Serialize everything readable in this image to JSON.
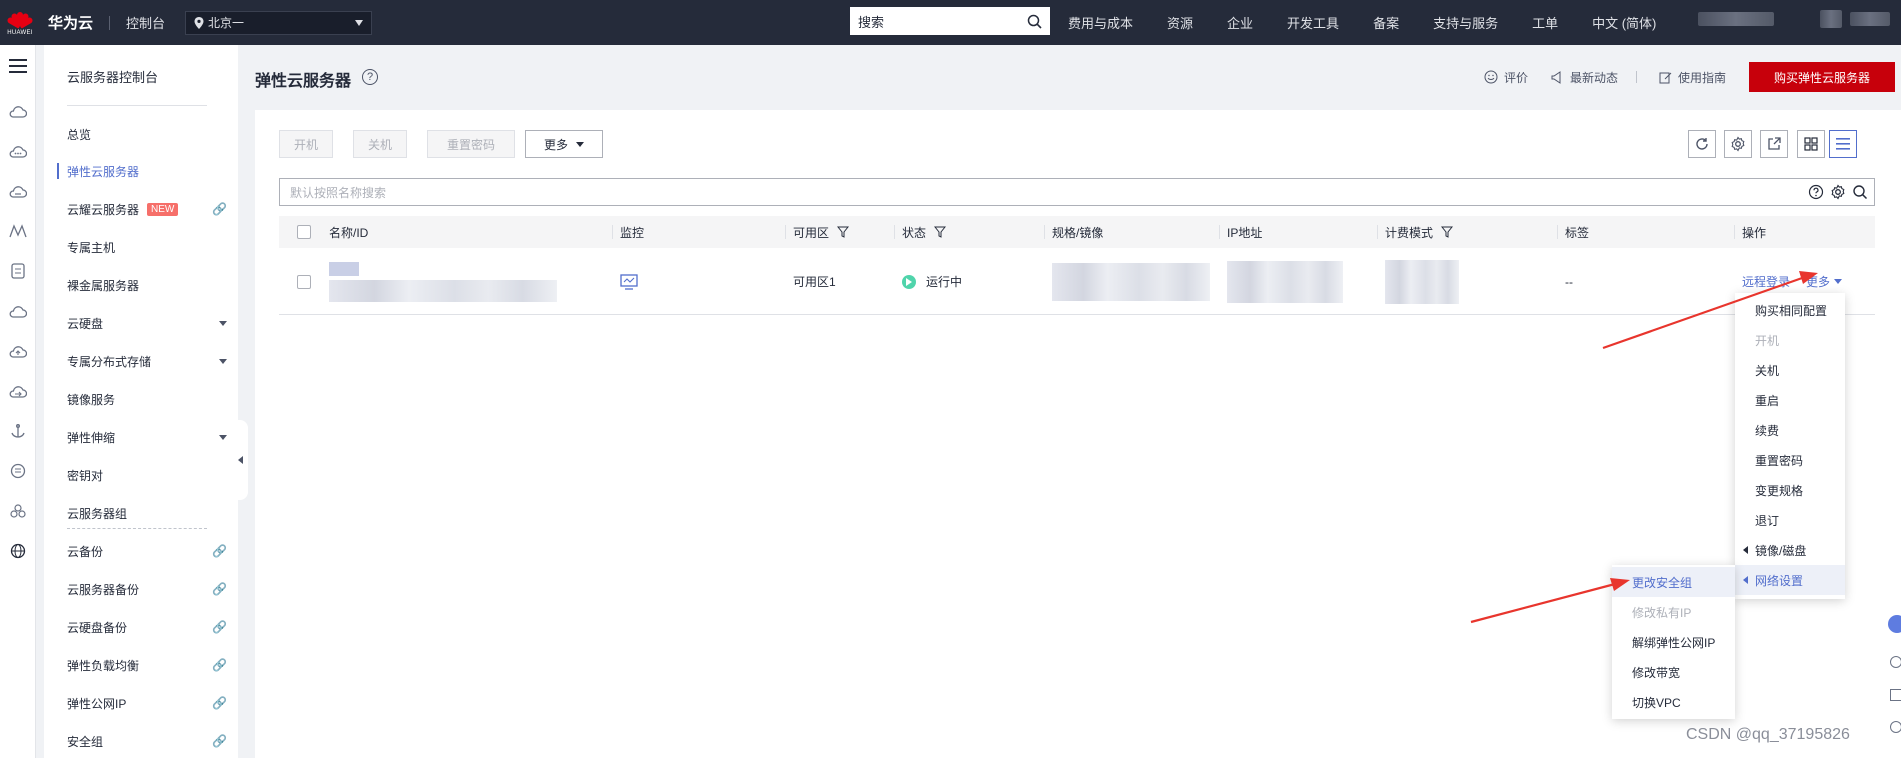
{
  "topbar": {
    "logo_text": "HUAWEI",
    "brand": "华为云",
    "console": "控制台",
    "region": "北京一",
    "search_placeholder": "搜索",
    "nav": [
      "费用与成本",
      "资源",
      "企业",
      "开发工具",
      "备案",
      "支持与服务",
      "工单",
      "中文 (简体)"
    ]
  },
  "rail_icons": [
    "menu-icon",
    "cloud-icon",
    "cloud-chat-icon",
    "cloud-sync-icon",
    "chart-icon",
    "document-icon",
    "cloud-outline-icon",
    "cloud-upload-icon",
    "cloud-arrow-icon",
    "anchor-icon",
    "tag-icon",
    "cluster-icon",
    "globe-icon"
  ],
  "sidebar": {
    "title": "云服务器控制台",
    "items": [
      {
        "label": "总览"
      },
      {
        "label": "弹性云服务器",
        "active": true
      },
      {
        "label": "云耀云服务器",
        "badge": "NEW",
        "trail": "link"
      },
      {
        "label": "专属主机"
      },
      {
        "label": "裸金属服务器"
      },
      {
        "label": "云硬盘",
        "trail": "chevron"
      },
      {
        "label": "专属分布式存储",
        "trail": "chevron"
      },
      {
        "label": "镜像服务"
      },
      {
        "label": "弹性伸缩",
        "trail": "chevron"
      },
      {
        "label": "密钥对"
      },
      {
        "label": "云服务器组"
      },
      {
        "label": "云备份",
        "trail": "link"
      },
      {
        "label": "云服务器备份",
        "trail": "link"
      },
      {
        "label": "云硬盘备份",
        "trail": "link"
      },
      {
        "label": "弹性负载均衡",
        "trail": "link"
      },
      {
        "label": "弹性公网IP",
        "trail": "link"
      },
      {
        "label": "安全组",
        "trail": "link"
      }
    ]
  },
  "page": {
    "title": "弹性云服务器",
    "rate": "评价",
    "news": "最新动态",
    "guide": "使用指南",
    "buy": "购买弹性云服务器"
  },
  "toolbar": {
    "start": "开机",
    "stop": "关机",
    "reset_pwd": "重置密码",
    "more": "更多"
  },
  "filter": {
    "placeholder": "默认按照名称搜索"
  },
  "table": {
    "headers": [
      "名称/ID",
      "监控",
      "可用区",
      "状态",
      "规格/镜像",
      "IP地址",
      "计费模式",
      "标签",
      "操作"
    ],
    "row": {
      "zone": "可用区1",
      "status": "运行中",
      "tags": "--",
      "remote_login": "远程登录",
      "more": "更多"
    }
  },
  "more_menu": [
    {
      "label": "购买相同配置"
    },
    {
      "label": "开机",
      "disabled": true
    },
    {
      "label": "关机"
    },
    {
      "label": "重启"
    },
    {
      "label": "续费"
    },
    {
      "label": "重置密码"
    },
    {
      "label": "变更规格"
    },
    {
      "label": "退订"
    },
    {
      "label": "镜像/磁盘",
      "submenu": true
    },
    {
      "label": "网络设置",
      "submenu": true,
      "highlighted": true
    }
  ],
  "network_menu": [
    {
      "label": "更改安全组",
      "highlighted": true
    },
    {
      "label": "修改私有IP",
      "disabled": true
    },
    {
      "label": "解绑弹性公网IP"
    },
    {
      "label": "修改带宽"
    },
    {
      "label": "切换VPC"
    }
  ],
  "watermark": "CSDN @qq_37195826",
  "colors": {
    "topbar": "#252b3a",
    "accent": "#526ecc",
    "buy": "#c7000b",
    "arrow": "#e8352d",
    "running": "#50d4ab"
  }
}
